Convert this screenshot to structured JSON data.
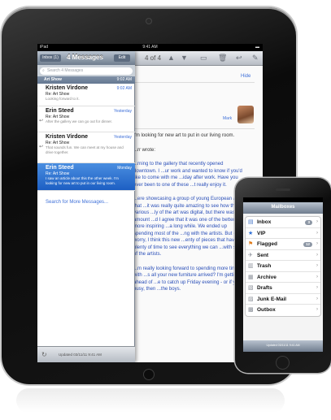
{
  "ipad": {
    "status": {
      "carrier": "iPad",
      "time": "9:41 AM"
    },
    "mail_list": {
      "back_label": "Inbox (1)",
      "title": "4 Messages",
      "edit_label": "Edit",
      "search_placeholder": "Search 4 Messages",
      "thread_header": {
        "label": "Art Show",
        "time": "9:02 AM"
      },
      "messages": [
        {
          "from": "Kristen Virdone",
          "time": "9:02 AM",
          "subject": "Re: Art Show",
          "preview": "Looking forward to it."
        },
        {
          "from": "Erin Steed",
          "time": "Yesterday",
          "subject": "Re: Art Show",
          "preview": "After the gallery we can go out for dinner."
        },
        {
          "from": "Kristen Virdone",
          "time": "Yesterday",
          "subject": "Re: Art Show",
          "preview": "That sounds fun. We can meet at my house and drive together."
        },
        {
          "from": "Erin Steed",
          "time": "Monday",
          "subject": "Re: Art Show",
          "preview": "I saw an article about this the other week. I'm looking for new art to put in our living room."
        }
      ],
      "search_more": "Search for More Messages...",
      "footer_updated": "Updated 03/11/11 9:41 AM"
    },
    "reading": {
      "counter": "4 of 4",
      "hide": "Hide",
      "to_name": "Mark",
      "body": [
        "I'm looking for new art to put in our living room.",
        "...rr wrote:",
        "...rning to the gallery that recently opened downtown. I ...ur work and wanted to know if you'd like to come with me ...iday after work. Have you ever been to one of these ...t really enjoy it.",
        "...ere showcasing a group of young European artists that ...it was really quite amazing to see how their various ...ly of the art was digital, but there was a fair amount ...d I agree that it was one of the better, more inspiring ...a long while. We ended up spending most of the ...ng with the artists. But don't worry, I think this new ...enty of pieces that have plenty of time to see everything we can ...with some of the artists.",
        "...m really looking forward to spending more time with ...s all your new furniture arrived? I'm getting ahead of ...e to catch up Friday evening - or if you're busy, then ...the boys."
      ]
    }
  },
  "iphone": {
    "title": "Mailboxes",
    "mailboxes": [
      {
        "icon": "inbox-icon",
        "label": "Inbox",
        "badge": "3"
      },
      {
        "icon": "vip-star-icon",
        "label": "VIP",
        "badge": ""
      },
      {
        "icon": "flag-icon",
        "label": "Flagged",
        "badge": "12"
      },
      {
        "icon": "sent-icon",
        "label": "Sent",
        "badge": ""
      },
      {
        "icon": "trash-icon",
        "label": "Trash",
        "badge": ""
      },
      {
        "icon": "archive-icon",
        "label": "Archive",
        "badge": ""
      },
      {
        "icon": "drafts-icon",
        "label": "Drafts",
        "badge": ""
      },
      {
        "icon": "junk-icon",
        "label": "Junk E-Mail",
        "badge": ""
      },
      {
        "icon": "outbox-icon",
        "label": "Outbox",
        "badge": ""
      }
    ],
    "footer_updated": "Updated 03/11/11 9:41 AM"
  },
  "colors": {
    "accent_blue": "#3d6fd8",
    "selected_row": "#1d5fc3",
    "toolbar": "#6f7d8e"
  }
}
